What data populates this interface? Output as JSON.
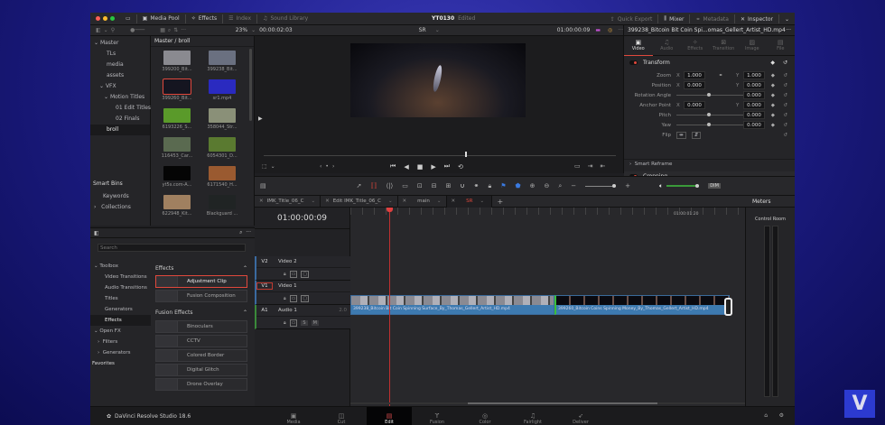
{
  "app": {
    "project": "YT0130",
    "status": "Edited",
    "product": "DaVinci Resolve Studio 18.6"
  },
  "titlebar": {
    "media_pool": "Media Pool",
    "effects": "Effects",
    "index": "Index",
    "sound_library": "Sound Library",
    "quick_export": "Quick Export",
    "mixer": "Mixer",
    "metadata": "Metadata",
    "inspector": "Inspector"
  },
  "viewer": {
    "zoom": "23%",
    "duration": "00:00:02:03",
    "timeline_name": "SR",
    "timecode": "01:00:00:09"
  },
  "media_pool": {
    "path": "Master / broll",
    "bins": [
      {
        "label": "Master"
      },
      {
        "label": "TLs"
      },
      {
        "label": "media"
      },
      {
        "label": "assets"
      },
      {
        "label": "VFX"
      },
      {
        "label": "Motion Titles"
      },
      {
        "label": "01 Edit Titles"
      },
      {
        "label": "02 Finals"
      },
      {
        "label": "broll"
      }
    ],
    "smart_bins": "Smart Bins",
    "smart_items": [
      {
        "label": "Keywords"
      },
      {
        "label": "Collections"
      }
    ],
    "clips": [
      {
        "label": "399200_Bit...",
        "color": "#8a8a90"
      },
      {
        "label": "399238_Bit...",
        "color": "#6a7080"
      },
      {
        "label": "399260_Bit...",
        "color": "#151520"
      },
      {
        "label": "sr1.mp4",
        "color": "#2a2ac0"
      },
      {
        "label": "6193226_S...",
        "color": "#5a9a2a"
      },
      {
        "label": "358044_Str...",
        "color": "#8a9078"
      },
      {
        "label": "116453_Car...",
        "color": "#5a6a50"
      },
      {
        "label": "6054301_D...",
        "color": "#5a7a30"
      },
      {
        "label": "yt5s.com-A...",
        "color": "#050505"
      },
      {
        "label": "6171540_H...",
        "color": "#9a5a30"
      },
      {
        "label": "622948_Kit...",
        "color": "#a08060"
      },
      {
        "label": "Blackguard ...",
        "color": "#202424"
      }
    ]
  },
  "inspector": {
    "clip_name": "399238_Bitcoin Bit Coin Spi...omas_Gellert_Artist_HD.mp4",
    "tabs": [
      "Video",
      "Audio",
      "Effects",
      "Transition",
      "Image",
      "File"
    ],
    "transform": "Transform",
    "zoom": {
      "label": "Zoom",
      "x": "1.000",
      "y": "1.000"
    },
    "position": {
      "label": "Position",
      "x": "0.000",
      "y": "0.000"
    },
    "rotation": {
      "label": "Rotation Angle",
      "value": "0.000"
    },
    "anchor": {
      "label": "Anchor Point",
      "x": "0.000",
      "y": "0.000"
    },
    "pitch": {
      "label": "Pitch",
      "value": "0.000"
    },
    "yaw": {
      "label": "Yaw",
      "value": "0.000"
    },
    "flip": "Flip",
    "smart_reframe": "Smart Reframe",
    "cropping": "Cropping",
    "x_label": "X",
    "y_label": "Y"
  },
  "effects": {
    "search_placeholder": "Search",
    "tree": [
      {
        "label": "Toolbox"
      },
      {
        "label": "Video Transitions"
      },
      {
        "label": "Audio Transitions"
      },
      {
        "label": "Titles"
      },
      {
        "label": "Generators"
      },
      {
        "label": "Effects"
      },
      {
        "label": "Open FX"
      },
      {
        "label": "Filters"
      },
      {
        "label": "Generators"
      }
    ],
    "favorites": "Favorites",
    "section1": "Effects",
    "items1": [
      "Adjustment Clip",
      "Fusion Composition"
    ],
    "section2": "Fusion Effects",
    "items2": [
      "Binoculars",
      "CCTV",
      "Colored Border",
      "Digital Glitch",
      "Drone Overlay"
    ]
  },
  "timeline": {
    "tabs": [
      "IMK_Title_06_C",
      "Edit IMK_Title_06_C",
      "main",
      "SR"
    ],
    "timecode": "01:00:00:09",
    "ruler_mark": "01:00:01:20",
    "tracks": [
      {
        "id": "V2",
        "name": "Video 2"
      },
      {
        "id": "V1",
        "name": "Video 1"
      },
      {
        "id": "A1",
        "name": "Audio 1",
        "channels": "2.0"
      }
    ],
    "clips": [
      "399238_Bitcoin Bit Coin Spinning Surface_By_Thomas_Gellert_Artist_HD.mp4",
      "399260_Bitcoin Coins Spinning Money_By_Thomas_Gellert_Artist_HD.mp4"
    ],
    "dim": "DIM",
    "solo": "S",
    "mute": "M",
    "volume": 1.0
  },
  "meters": {
    "title": "Meters",
    "control_room": "Control Room"
  },
  "pages": [
    "Media",
    "Cut",
    "Edit",
    "Fusion",
    "Color",
    "Fairlight",
    "Deliver"
  ],
  "active_page": "Edit",
  "brand": {
    "logo_letter": "V",
    "accent": "#e0483c"
  }
}
